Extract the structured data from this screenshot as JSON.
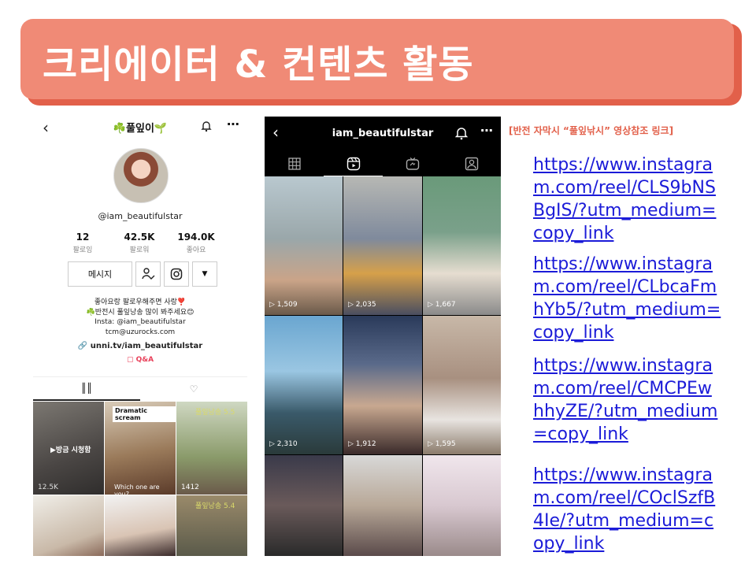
{
  "slide": {
    "title": "크리에이터 & 컨텐츠 활동",
    "colors": {
      "banner": "#f08a76",
      "banner_shadow": "#e2604a",
      "link": "#1b1bd8",
      "accent_red": "#e2604a"
    }
  },
  "tiktok_profile": {
    "back_icon": "chevron-left-icon",
    "display_name": "☘️풀잎이🌱",
    "bell_icon": "bell-icon",
    "more_icon": "more-icon",
    "handle": "@iam_beautifulstar",
    "stats": [
      {
        "value": "12",
        "label": "팔로잉"
      },
      {
        "value": "42.5K",
        "label": "팔로워"
      },
      {
        "value": "194.0K",
        "label": "좋아요"
      }
    ],
    "message_button": "메시지",
    "bio_lines": [
      "좋아요랑 팔로우해주면 사랑❣️",
      "☘️반전시 풀잎낭송 많이 봐주세요😊",
      "Insta: @iam_beautifulstar",
      "tcm@uzurocks.com"
    ],
    "link": "unni.tv/iam_beautifulstar",
    "qa_label": "Q&A",
    "tabs": [
      "videos-grid-icon",
      "liked-icon"
    ],
    "videos": [
      {
        "caption": "▶방금 시청함",
        "views": "12.5K"
      },
      {
        "caption": "Dramatic scream",
        "sub": "Which one are you?",
        "views": ""
      },
      {
        "caption": "풀잎낭송 5.5",
        "views": "1412"
      },
      {
        "caption": "",
        "views": ""
      },
      {
        "caption": "",
        "views": ""
      },
      {
        "caption": "풀잎낭송 5.4",
        "views": ""
      }
    ]
  },
  "instagram_reels": {
    "username": "iam_beautifulstar",
    "back_icon": "chevron-left-icon",
    "tabs": [
      "grid-icon",
      "reels-icon",
      "igtv-icon",
      "tagged-icon"
    ],
    "reels": [
      {
        "views": "1,509"
      },
      {
        "views": "2,035"
      },
      {
        "views": "1,667"
      },
      {
        "views": "2,310"
      },
      {
        "views": "1,912"
      },
      {
        "views": "1,595"
      },
      {
        "views": ""
      },
      {
        "views": ""
      },
      {
        "views": ""
      }
    ]
  },
  "links_section": {
    "header": "[반전 자막시 “풀잎낚시” 영상참조 링크]",
    "links": [
      "https://www.instagram.com/reel/CLS9bNSBgIS/?utm_medium=copy_link",
      "https://www.instagram.com/reel/CLbcaFmhYb5/?utm_medium=copy_link",
      "https://www.instagram.com/reel/CMCPEwhhyZE/?utm_medium=copy_link",
      "https://www.instagram.com/reel/COclSzfB4Ie/?utm_medium=copy_link"
    ]
  }
}
